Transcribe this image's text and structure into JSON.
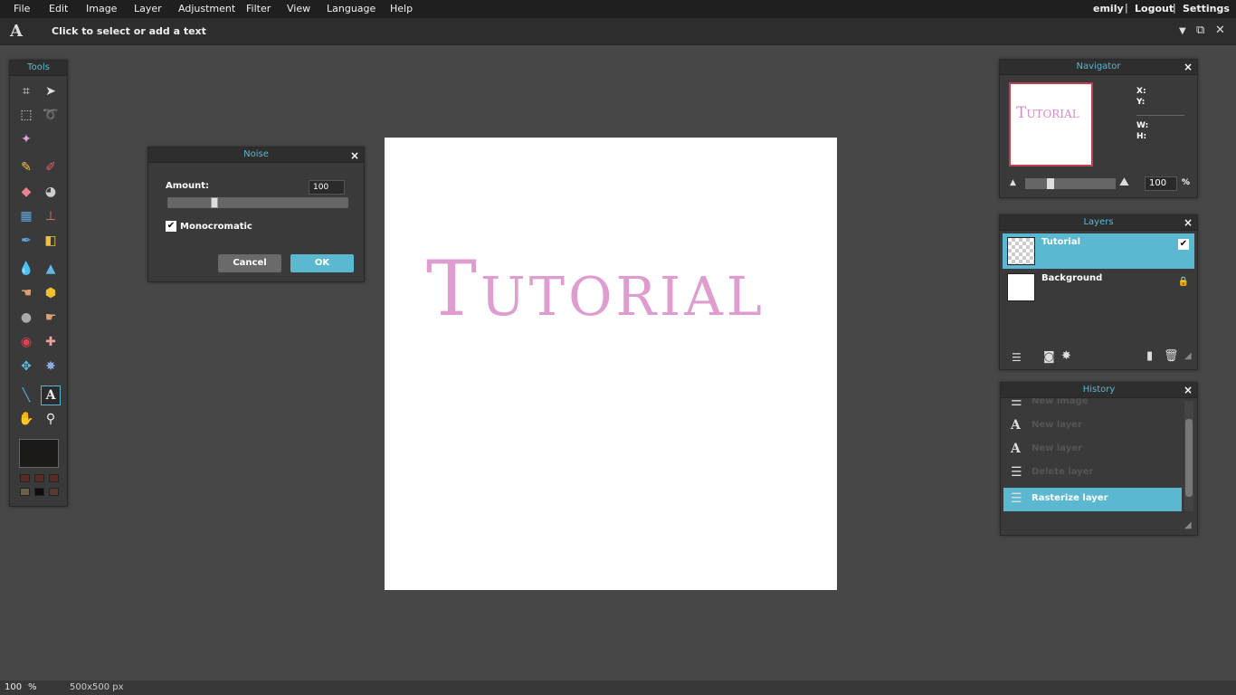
{
  "menu": {
    "items": [
      "File",
      "Edit",
      "Image",
      "Layer",
      "Adjustment",
      "Filter",
      "View",
      "Language",
      "Help"
    ],
    "user": "emily",
    "logout": "Logout",
    "settings": "Settings"
  },
  "options_bar": {
    "tool_glyph": "A",
    "hint": "Click to select or add a text"
  },
  "tools_panel": {
    "title": "Tools",
    "foreground_color": "#1c1a17",
    "swatches": [
      "#5a2a24",
      "#5a2a24",
      "#5a2a24",
      "#6a6248",
      "#0e0e0e",
      "#5a3a30"
    ]
  },
  "canvas": {
    "text": "Tutorial",
    "text_color": "#d98bc7"
  },
  "noise_dialog": {
    "title": "Noise",
    "amount_label": "Amount:",
    "amount_value": "100",
    "amount_fraction": 0.25,
    "monochromatic_label": "Monocromatic",
    "monochromatic_checked": true,
    "cancel_label": "Cancel",
    "ok_label": "OK"
  },
  "navigator": {
    "title": "Navigator",
    "thumb_text": "Tutorial",
    "x_label": "X:",
    "y_label": "Y:",
    "w_label": "W:",
    "h_label": "H:",
    "zoom_value": "100",
    "zoom_unit": "%"
  },
  "layers": {
    "title": "Layers",
    "items": [
      {
        "name": "Tutorial",
        "selected": true,
        "visible": true
      },
      {
        "name": "Background",
        "selected": false,
        "locked": true
      }
    ]
  },
  "history": {
    "title": "History",
    "items": [
      {
        "label": "New image",
        "icon": "history-action-icon"
      },
      {
        "label": "New layer",
        "icon": "text-icon"
      },
      {
        "label": "New layer",
        "icon": "text-icon"
      },
      {
        "label": "Delete layer",
        "icon": "history-action-icon"
      },
      {
        "label": "Rasterize layer",
        "icon": "history-action-icon",
        "selected": true
      }
    ]
  },
  "status": {
    "zoom": "100",
    "zoom_unit": "%",
    "dimensions": "500x500 px"
  },
  "colors": {
    "accent": "#5ab8d0",
    "button_grey": "#6a6a6a"
  }
}
